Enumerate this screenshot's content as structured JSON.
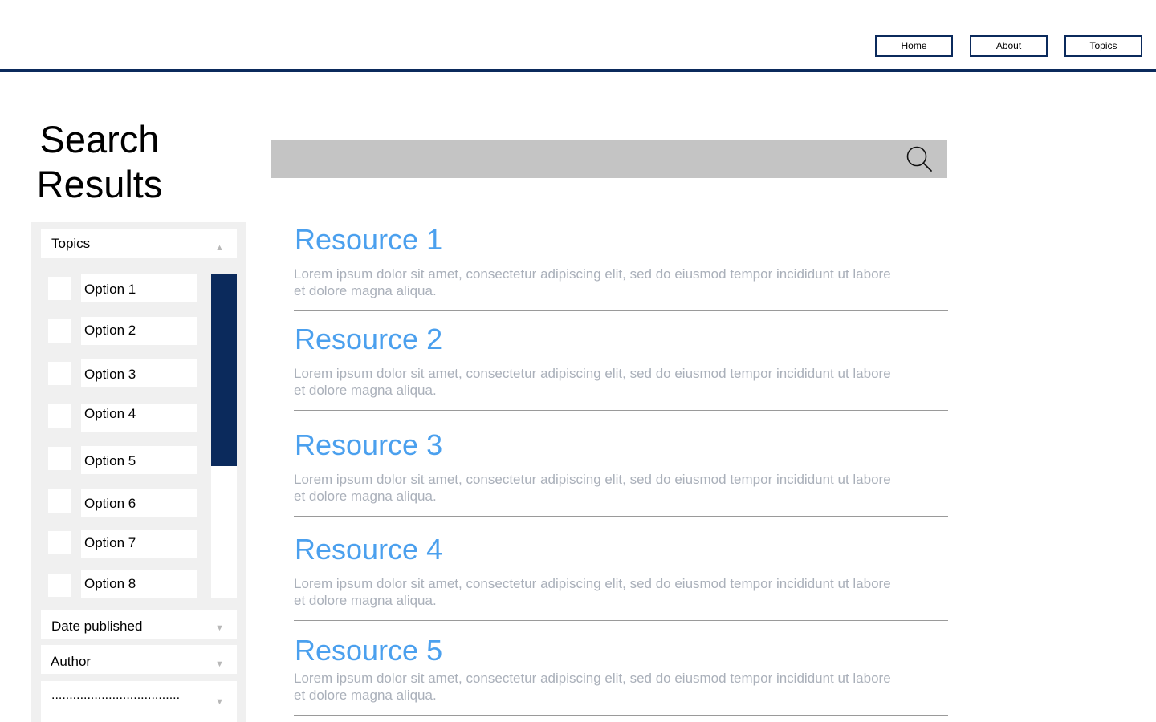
{
  "nav": {
    "items": [
      {
        "label": "Home"
      },
      {
        "label": "About"
      },
      {
        "label": "Topics"
      }
    ]
  },
  "page": {
    "title": "Search Results"
  },
  "search": {
    "value": "",
    "placeholder": "",
    "icon": "search-icon"
  },
  "filters": {
    "topics": {
      "label": "Topics",
      "state": "expanded",
      "options": [
        {
          "label": "Option 1",
          "checked": false
        },
        {
          "label": "Option 2",
          "checked": false
        },
        {
          "label": "Option 3",
          "checked": false
        },
        {
          "label": "Option 4",
          "checked": false
        },
        {
          "label": "Option 5",
          "checked": false
        },
        {
          "label": "Option 6",
          "checked": false
        },
        {
          "label": "Option 7",
          "checked": false
        },
        {
          "label": "Option 8",
          "checked": false
        }
      ]
    },
    "date_published": {
      "label": "Date published",
      "state": "collapsed"
    },
    "author": {
      "label": "Author",
      "state": "collapsed"
    },
    "more": {
      "label": "....................................",
      "state": "collapsed"
    }
  },
  "results": [
    {
      "title": "Resource 1",
      "description": "Lorem ipsum dolor sit amet, consectetur adipiscing elit, sed do eiusmod tempor incididunt ut labore et dolore magna aliqua."
    },
    {
      "title": "Resource 2",
      "description": "Lorem ipsum dolor sit amet, consectetur adipiscing elit, sed do eiusmod tempor incididunt ut labore et dolore magna aliqua."
    },
    {
      "title": "Resource 3",
      "description": "Lorem ipsum dolor sit amet, consectetur adipiscing elit, sed do eiusmod tempor incididunt ut labore et dolore magna aliqua."
    },
    {
      "title": "Resource 4",
      "description": "Lorem ipsum dolor sit amet, consectetur adipiscing elit, sed do eiusmod tempor incididunt ut labore et dolore magna aliqua."
    },
    {
      "title": "Resource 5",
      "description": "Lorem ipsum dolor sit amet, consectetur adipiscing elit, sed do eiusmod tempor incididunt ut labore et dolore magna aliqua."
    }
  ],
  "colors": {
    "brand_navy": "#0b2a5c",
    "link_blue": "#4ba0ee",
    "muted_text": "#aab0ba",
    "search_bg": "#c4c4c4",
    "sidebar_bg": "#f0f0f0"
  }
}
